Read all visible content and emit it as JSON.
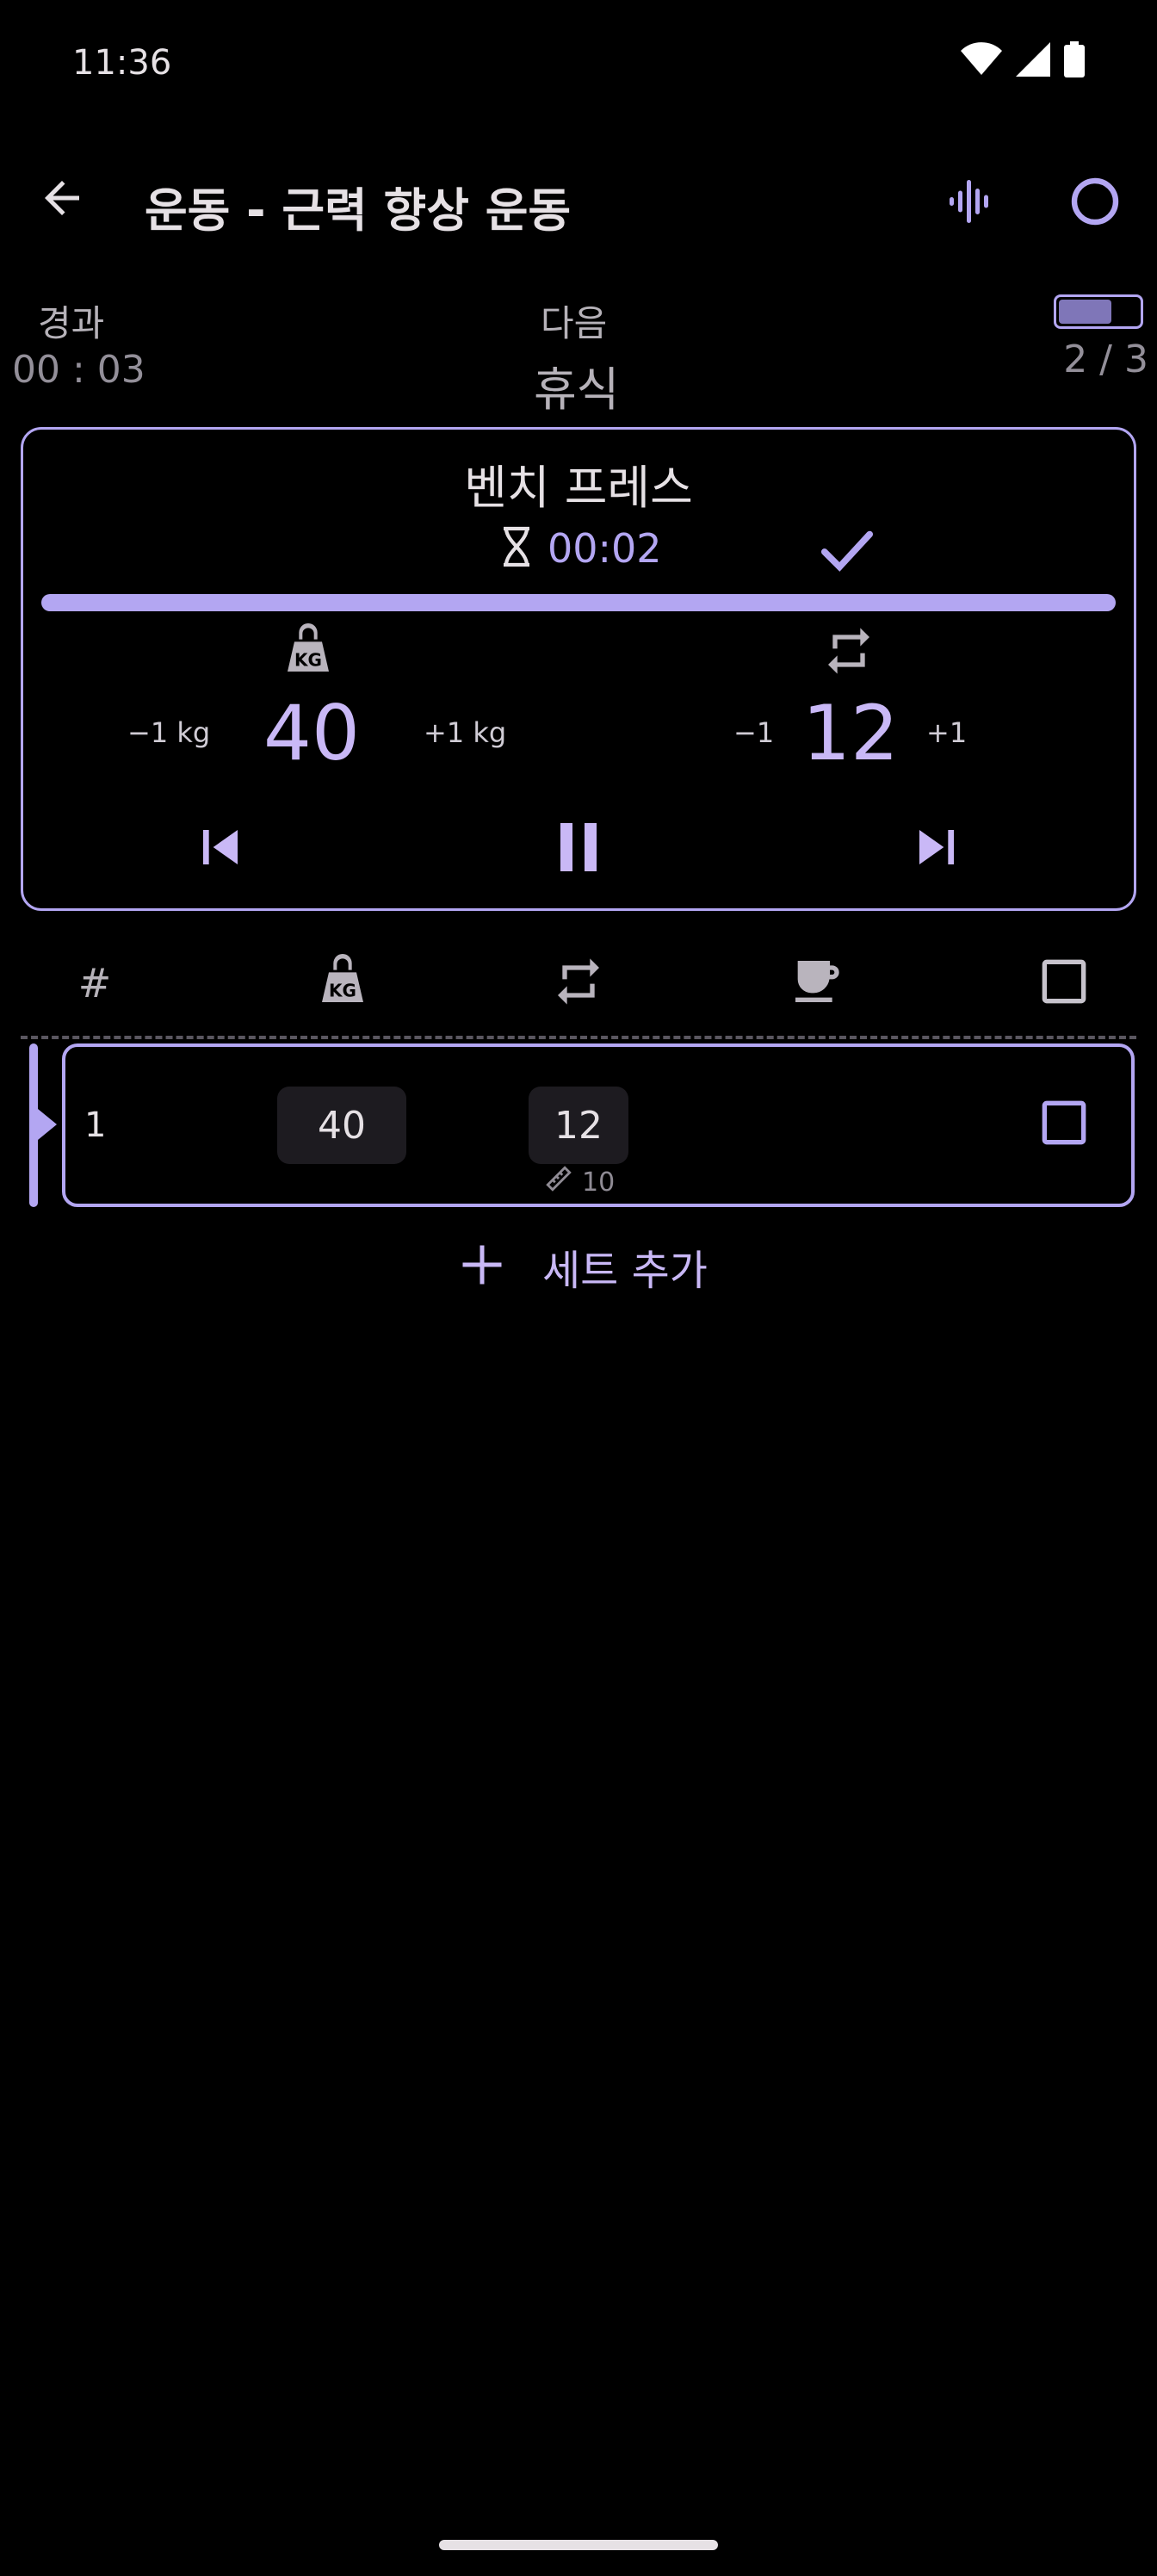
{
  "status_bar": {
    "time": "11:36",
    "icons": [
      "wifi-icon",
      "signal-icon",
      "battery-icon"
    ]
  },
  "top_bar": {
    "title": "운동 - 근력 향상 운동",
    "actions": [
      "back-arrow-icon",
      "waveform-icon",
      "circle-icon"
    ]
  },
  "summary": {
    "elapsed_label": "경과",
    "elapsed_value": "00 : 03",
    "next_label": "다음",
    "next_value": "휴식",
    "progress_text": "2 / 3",
    "progress_fraction": 0.66
  },
  "current": {
    "exercise_name": "벤치 프레스",
    "timer": "00:02",
    "progress_fraction": 1.0,
    "weight": "40",
    "weight_minus": "−1 kg",
    "weight_plus": "+1 kg",
    "reps": "12",
    "reps_minus": "−1",
    "reps_plus": "+1"
  },
  "table_header": {
    "index_label": "#"
  },
  "sets": [
    {
      "index": "1",
      "weight": "40",
      "reps": "12",
      "previous_reps": "10",
      "checked": false
    }
  ],
  "add_set_label": "세트 추가",
  "colors": {
    "accent": "#b3a6f2",
    "accent_text": "#c9b8f6",
    "background": "#000000",
    "cell_bg": "#1d1b20"
  }
}
